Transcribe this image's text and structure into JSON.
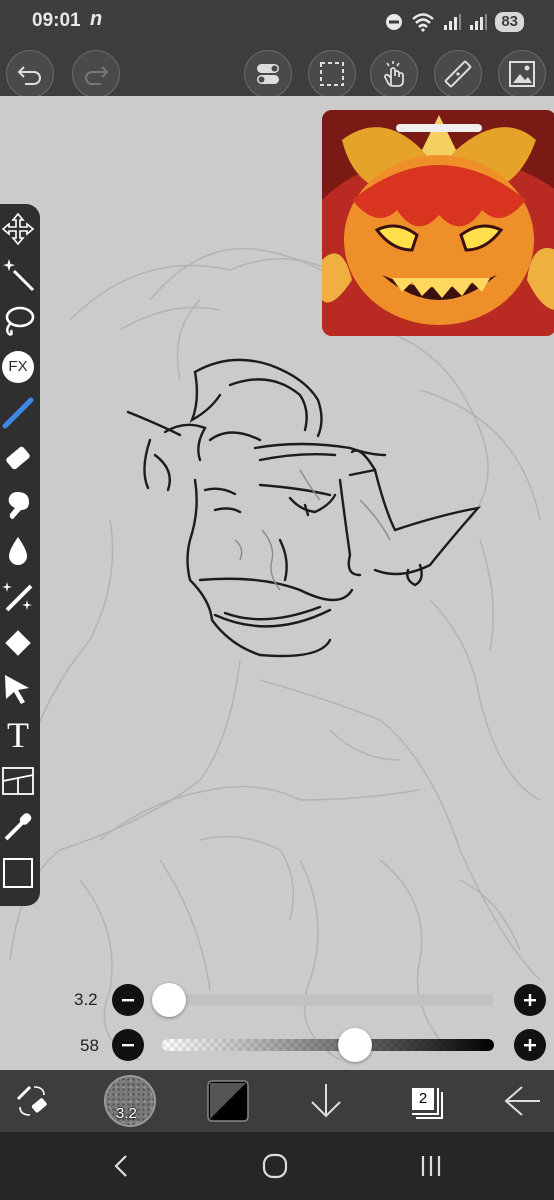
{
  "status_bar": {
    "time": "09:01",
    "app_glyph": "n",
    "battery": "83",
    "icons": [
      "do-not-disturb-icon",
      "wifi-icon",
      "signal-icon",
      "signal-icon",
      "battery-icon"
    ]
  },
  "top_toolbar": {
    "buttons": [
      "undo-icon",
      "redo-icon",
      "toggle-icon",
      "selection-icon",
      "gesture-icon",
      "ruler-icon",
      "image-icon"
    ]
  },
  "reference": {
    "description": "reference image window"
  },
  "tools": [
    "move",
    "magic-wand",
    "lasso",
    "filter",
    "brush",
    "eraser",
    "smudge",
    "blur",
    "special-brush",
    "fill",
    "select",
    "text",
    "frame-divider",
    "eyedropper",
    "canvas"
  ],
  "tool_labels": {
    "filter": "FX",
    "text": "T"
  },
  "brush_size": {
    "value_label": "3.2",
    "level": 0.02
  },
  "brush_opacity": {
    "value_label": "58",
    "level": 0.58
  },
  "bottom_toolbar": {
    "brush_size_label": "3.2",
    "layer_count": "2"
  },
  "colors": {
    "bar_bg": "#3d3d3d",
    "canvas_bg": "#cbcbcb",
    "accent_blue": "#3f88e6",
    "nav_bg": "#262626"
  }
}
